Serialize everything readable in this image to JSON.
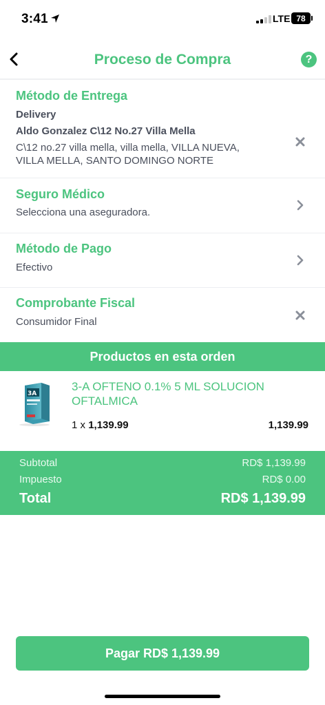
{
  "status_bar": {
    "time": "3:41",
    "network": "LTE",
    "battery": "78"
  },
  "header": {
    "title": "Proceso de Compra",
    "back_icon": "chevron-left-icon",
    "help_label": "?"
  },
  "sections": {
    "delivery": {
      "title": "Método de Entrega",
      "method": "Delivery",
      "recipient": "Aldo Gonzalez C\\12 No.27 Villa Mella",
      "address_line1": "C\\12 no.27 villa mella, villa mella,  VILLA NUEVA,",
      "address_line2": "VILLA MELLA, SANTO DOMINGO NORTE",
      "action_icon": "close-icon"
    },
    "seguro": {
      "title": "Seguro Médico",
      "value": "Selecciona una aseguradora.",
      "action_icon": "chevron-right-icon"
    },
    "pago": {
      "title": "Método de Pago",
      "value": "Efectivo",
      "action_icon": "chevron-right-icon"
    },
    "fiscal": {
      "title": "Comprobante Fiscal",
      "value": "Consumidor Final",
      "action_icon": "close-icon"
    }
  },
  "products": {
    "banner": "Productos en esta orden",
    "items": [
      {
        "name": "3-A OFTENO 0.1% 5 ML SOLUCION OFTALMICA",
        "qty_prefix": "1 x",
        "unit_price": "1,139.99",
        "line_total": "1,139.99"
      }
    ]
  },
  "totals": {
    "subtotal_label": "Subtotal",
    "subtotal_value": "RD$ 1,139.99",
    "tax_label": "Impuesto",
    "tax_value": "RD$ 0.00",
    "total_label": "Total",
    "total_value": "RD$ 1,139.99"
  },
  "pay_button": {
    "label": "Pagar RD$ 1,139.99"
  },
  "colors": {
    "accent": "#4cc47f",
    "text": "#4a4f5c",
    "icon_gray": "#8a8f99"
  }
}
